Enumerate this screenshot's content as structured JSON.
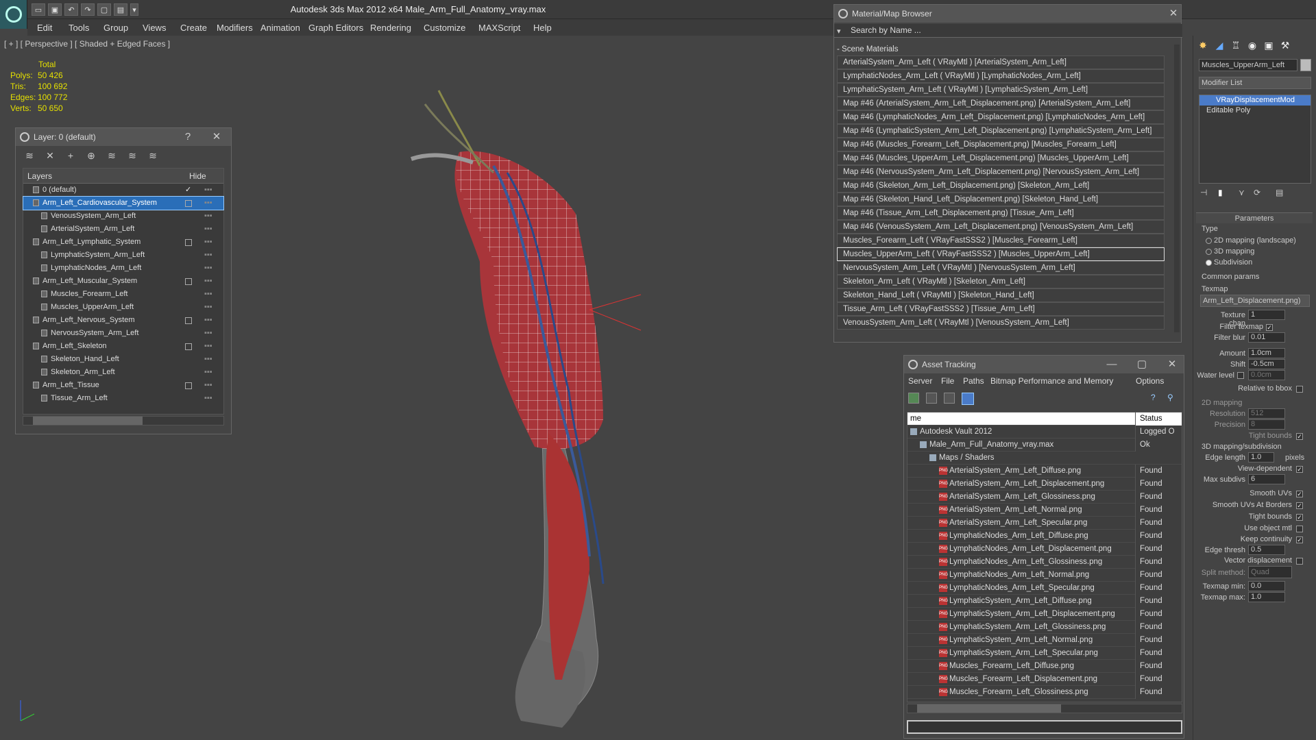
{
  "app": {
    "title": "Autodesk 3ds Max  2012 x64      Male_Arm_Full_Anatomy_vray.max",
    "menu": [
      "Edit",
      "Tools",
      "Group",
      "Views",
      "Create",
      "Modifiers",
      "Animation",
      "Graph Editors",
      "Rendering",
      "Customize",
      "MAXScript",
      "Help"
    ],
    "viewport_label": "[ + ] [ Perspective ] [ Shaded + Edged Faces ]"
  },
  "stats": {
    "header": "Total",
    "rows": [
      {
        "k": "Polys:",
        "v": "50 426"
      },
      {
        "k": "Tris:",
        "v": "100 692"
      },
      {
        "k": "Edges:",
        "v": "100 772"
      },
      {
        "k": "Verts:",
        "v": "50 650"
      }
    ]
  },
  "layer_panel": {
    "title": "Layer: 0 (default)",
    "help": "?",
    "close": "✕",
    "col_layers": "Layers",
    "col_hide": "Hide",
    "rows": [
      {
        "label": "0 (default)",
        "indent": 1,
        "check": "✓",
        "box": false,
        "sel": false
      },
      {
        "label": "Arm_Left_Cardiovascular_System",
        "indent": 0,
        "check": "",
        "box": true,
        "sel": true
      },
      {
        "label": "VenousSystem_Arm_Left",
        "indent": 2,
        "check": "",
        "box": false,
        "sel": false
      },
      {
        "label": "ArterialSystem_Arm_Left",
        "indent": 2,
        "check": "",
        "box": false,
        "sel": false
      },
      {
        "label": "Arm_Left_Lymphatic_System",
        "indent": 0,
        "check": "",
        "box": true,
        "sel": false
      },
      {
        "label": "LymphaticSystem_Arm_Left",
        "indent": 2,
        "check": "",
        "box": false,
        "sel": false
      },
      {
        "label": "LymphaticNodes_Arm_Left",
        "indent": 2,
        "check": "",
        "box": false,
        "sel": false
      },
      {
        "label": "Arm_Left_Muscular_System",
        "indent": 0,
        "check": "",
        "box": true,
        "sel": false
      },
      {
        "label": "Muscles_Forearm_Left",
        "indent": 2,
        "check": "",
        "box": false,
        "sel": false
      },
      {
        "label": "Muscles_UpperArm_Left",
        "indent": 2,
        "check": "",
        "box": false,
        "sel": false
      },
      {
        "label": "Arm_Left_Nervous_System",
        "indent": 0,
        "check": "",
        "box": true,
        "sel": false
      },
      {
        "label": "NervousSystem_Arm_Left",
        "indent": 2,
        "check": "",
        "box": false,
        "sel": false
      },
      {
        "label": "Arm_Left_Skeleton",
        "indent": 0,
        "check": "",
        "box": true,
        "sel": false
      },
      {
        "label": "Skeleton_Hand_Left",
        "indent": 2,
        "check": "",
        "box": false,
        "sel": false
      },
      {
        "label": "Skeleton_Arm_Left",
        "indent": 2,
        "check": "",
        "box": false,
        "sel": false
      },
      {
        "label": "Arm_Left_Tissue",
        "indent": 0,
        "check": "",
        "box": true,
        "sel": false
      },
      {
        "label": "Tissue_Arm_Left",
        "indent": 2,
        "check": "",
        "box": false,
        "sel": false
      }
    ]
  },
  "material_browser": {
    "title": "Material/Map Browser",
    "search_placeholder": "Search by Name ...",
    "section": "- Scene Materials",
    "items": [
      "ArterialSystem_Arm_Left  ( VRayMtl )  [ArterialSystem_Arm_Left]",
      "LymphaticNodes_Arm_Left  ( VRayMtl )  [LymphaticNodes_Arm_Left]",
      "LymphaticSystem_Arm_Left  ( VRayMtl )  [LymphaticSystem_Arm_Left]",
      "Map #46 (ArterialSystem_Arm_Left_Displacement.png) [ArterialSystem_Arm_Left]",
      "Map #46 (LymphaticNodes_Arm_Left_Displacement.png) [LymphaticNodes_Arm_Left]",
      "Map #46 (LymphaticSystem_Arm_Left_Displacement.png) [LymphaticSystem_Arm_Left]",
      "Map #46 (Muscles_Forearm_Left_Displacement.png) [Muscles_Forearm_Left]",
      "Map #46 (Muscles_UpperArm_Left_Displacement.png) [Muscles_UpperArm_Left]",
      "Map #46 (NervousSystem_Arm_Left_Displacement.png) [NervousSystem_Arm_Left]",
      "Map #46 (Skeleton_Arm_Left_Displacement.png) [Skeleton_Arm_Left]",
      "Map #46 (Skeleton_Hand_Left_Displacement.png) [Skeleton_Hand_Left]",
      "Map #46 (Tissue_Arm_Left_Displacement.png) [Tissue_Arm_Left]",
      "Map #46 (VenousSystem_Arm_Left_Displacement.png) [VenousSystem_Arm_Left]",
      "Muscles_Forearm_Left  ( VRayFastSSS2 )  [Muscles_Forearm_Left]",
      "Muscles_UpperArm_Left  ( VRayFastSSS2 )  [Muscles_UpperArm_Left]",
      "NervousSystem_Arm_Left  ( VRayMtl )  [NervousSystem_Arm_Left]",
      "Skeleton_Arm_Left  ( VRayMtl )  [Skeleton_Arm_Left]",
      "Skeleton_Hand_Left  ( VRayMtl )  [Skeleton_Hand_Left]",
      "Tissue_Arm_Left  ( VRayFastSSS2 )  [Tissue_Arm_Left]",
      "VenousSystem_Arm_Left  ( VRayMtl )  [VenousSystem_Arm_Left]"
    ],
    "selected_index": 14
  },
  "asset_tracking": {
    "title": "Asset Tracking",
    "menu": [
      "Server",
      "File",
      "Paths",
      "Bitmap Performance and Memory",
      "Options"
    ],
    "col_name": "me",
    "col_status": "Status",
    "rows": [
      {
        "name": "Autodesk Vault 2012",
        "status": "Logged O",
        "indent": 0,
        "png": false
      },
      {
        "name": "Male_Arm_Full_Anatomy_vray.max",
        "status": "Ok",
        "indent": 1,
        "png": false
      },
      {
        "name": "Maps / Shaders",
        "status": "",
        "indent": 2,
        "png": false
      },
      {
        "name": "ArterialSystem_Arm_Left_Diffuse.png",
        "status": "Found",
        "indent": 3,
        "png": true
      },
      {
        "name": "ArterialSystem_Arm_Left_Displacement.png",
        "status": "Found",
        "indent": 3,
        "png": true
      },
      {
        "name": "ArterialSystem_Arm_Left_Glossiness.png",
        "status": "Found",
        "indent": 3,
        "png": true
      },
      {
        "name": "ArterialSystem_Arm_Left_Normal.png",
        "status": "Found",
        "indent": 3,
        "png": true
      },
      {
        "name": "ArterialSystem_Arm_Left_Specular.png",
        "status": "Found",
        "indent": 3,
        "png": true
      },
      {
        "name": "LymphaticNodes_Arm_Left_Diffuse.png",
        "status": "Found",
        "indent": 3,
        "png": true
      },
      {
        "name": "LymphaticNodes_Arm_Left_Displacement.png",
        "status": "Found",
        "indent": 3,
        "png": true
      },
      {
        "name": "LymphaticNodes_Arm_Left_Glossiness.png",
        "status": "Found",
        "indent": 3,
        "png": true
      },
      {
        "name": "LymphaticNodes_Arm_Left_Normal.png",
        "status": "Found",
        "indent": 3,
        "png": true
      },
      {
        "name": "LymphaticNodes_Arm_Left_Specular.png",
        "status": "Found",
        "indent": 3,
        "png": true
      },
      {
        "name": "LymphaticSystem_Arm_Left_Diffuse.png",
        "status": "Found",
        "indent": 3,
        "png": true
      },
      {
        "name": "LymphaticSystem_Arm_Left_Displacement.png",
        "status": "Found",
        "indent": 3,
        "png": true
      },
      {
        "name": "LymphaticSystem_Arm_Left_Glossiness.png",
        "status": "Found",
        "indent": 3,
        "png": true
      },
      {
        "name": "LymphaticSystem_Arm_Left_Normal.png",
        "status": "Found",
        "indent": 3,
        "png": true
      },
      {
        "name": "LymphaticSystem_Arm_Left_Specular.png",
        "status": "Found",
        "indent": 3,
        "png": true
      },
      {
        "name": "Muscles_Forearm_Left_Diffuse.png",
        "status": "Found",
        "indent": 3,
        "png": true
      },
      {
        "name": "Muscles_Forearm_Left_Displacement.png",
        "status": "Found",
        "indent": 3,
        "png": true
      },
      {
        "name": "Muscles_Forearm_Left_Glossiness.png",
        "status": "Found",
        "indent": 3,
        "png": true
      }
    ]
  },
  "command_panel": {
    "object_name": "Muscles_UpperArm_Left",
    "modifier_list": "Modifier List",
    "stack": [
      "VRayDisplacementMod",
      "Editable Poly"
    ],
    "parameters_title": "Parameters",
    "type_label": "Type",
    "type_options": [
      {
        "label": "2D mapping (landscape)",
        "on": false
      },
      {
        "label": "3D mapping",
        "on": false
      },
      {
        "label": "Subdivision",
        "on": true
      }
    ],
    "common_params": "Common params",
    "texmap_label": "Texmap",
    "texmap_value": "Arm_Left_Displacement.png)",
    "fields": [
      {
        "label": "Texture chan",
        "value": "1"
      },
      {
        "label": "Filter blur",
        "value": "0.01"
      },
      {
        "label": "Amount",
        "value": "1.0cm"
      },
      {
        "label": "Shift",
        "value": "-0.5cm"
      },
      {
        "label": "Water level",
        "value": "0.0cm"
      }
    ],
    "filter_texmap": "Filter texmap",
    "relative_bbox": "Relative to bbox",
    "mapping2d_title": "2D mapping",
    "resolution_label": "Resolution",
    "resolution_value": "512",
    "precision_label": "Precision",
    "precision_value": "8",
    "tight_bounds": "Tight bounds",
    "subdiv_title": "3D mapping/subdivision",
    "edge_length_label": "Edge length",
    "edge_length_value": "1.0",
    "pixels": "pixels",
    "view_dependent": "View-dependent",
    "max_subdivs_label": "Max subdivs",
    "max_subdivs_value": "6",
    "checks": [
      "Smooth UVs",
      "Smooth UVs At Borders",
      "Tight bounds",
      "Use object mtl",
      "Keep continuity"
    ],
    "edge_thresh_label": "Edge thresh",
    "edge_thresh_value": "0.5",
    "vector_disp": "Vector displacement",
    "split_method_label": "Split method:",
    "split_method_value": "Quad",
    "texmap_min_label": "Texmap min:",
    "texmap_min_value": "0.0",
    "texmap_max_label": "Texmap max:",
    "texmap_max_value": "1.0"
  }
}
